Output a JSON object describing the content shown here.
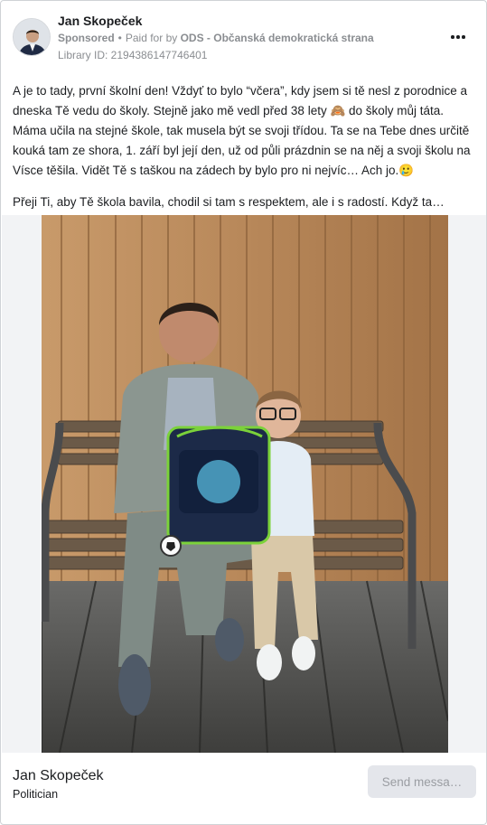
{
  "post": {
    "author": "Jan Skopeček",
    "sponsored": "Sponsored",
    "paid_prefix": "Paid for by",
    "payer": "ODS - Občanská demokratická strana",
    "library_id": "Library ID: 2194386147746401",
    "paragraphs": [
      "A je to tady, první školní den! Vždyť to bylo “včera”, kdy jsem si tě nesl z porodnice a dneska Tě vedu do školy. Stejně jako mě vedl před 38 lety 🙈 do školy můj táta. Máma učila na stejné škole, tak musela být se svoji třídou. Ta se na Tebe dnes určitě kouká tam ze shora, 1. září byl její den, už od půli prázdnin se na něj a svoji školu na Vísce těšila. Vidět Tě s taškou na zádech by bylo pro ni nejvíc… Ach jo.🥲",
      "Přeji Ti, aby Tě škola bavila, chodil si tam s respektem, ale i s radostí. Když ta…"
    ]
  },
  "footer": {
    "page_name": "Jan Skopeček",
    "category": "Politician",
    "send_label": "Send messa…"
  },
  "icons": {
    "more": "more-options-icon"
  }
}
